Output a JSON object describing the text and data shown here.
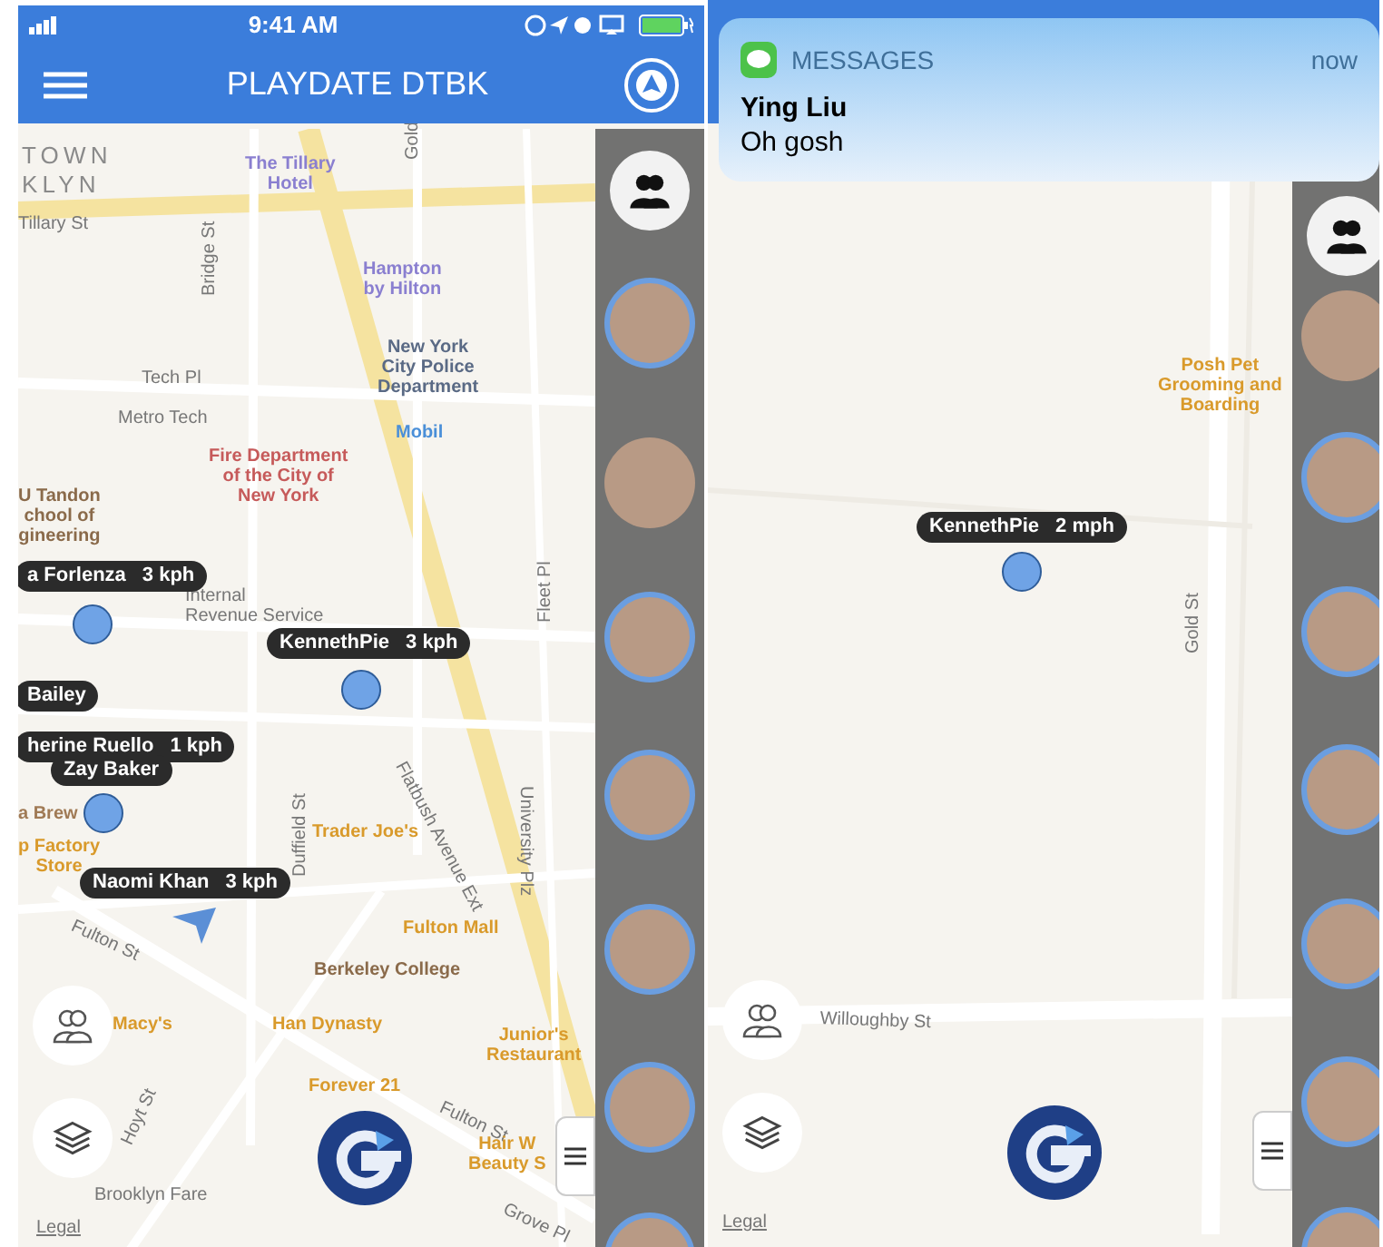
{
  "left_screen": {
    "status_bar": {
      "time": "9:41 AM"
    },
    "header": {
      "title": "PLAYDATE DTBK"
    },
    "map_labels": [
      {
        "text": "TOWN",
        "kind": "district"
      },
      {
        "text": "KLYN",
        "kind": "district"
      },
      {
        "text": "The Tillary\nHotel",
        "kind": "poi",
        "color": "#8a7fd0"
      },
      {
        "text": "Tillary St",
        "kind": "street"
      },
      {
        "text": "Gold",
        "kind": "street"
      },
      {
        "text": "Hampton\nby Hilton",
        "kind": "poi",
        "color": "#8a7fd0"
      },
      {
        "text": "Bridge St",
        "kind": "street"
      },
      {
        "text": "New York\nCity Police\nDepartment",
        "kind": "poi",
        "color": "#5a6a85"
      },
      {
        "text": "Tech Pl",
        "kind": "street"
      },
      {
        "text": "Metro Tech",
        "kind": "street"
      },
      {
        "text": "Fire Department\nof the City of\nNew York",
        "kind": "poi",
        "color": "#c65a5a"
      },
      {
        "text": "Mobil",
        "kind": "poi",
        "color": "#4a8fd8"
      },
      {
        "text": "U Tandon\nchool of\ngineering",
        "kind": "poi",
        "color": "#8a6a4a"
      },
      {
        "text": "Internal\nRevenue Service",
        "kind": "street"
      },
      {
        "text": "Fleet Pl",
        "kind": "street"
      },
      {
        "text": "Flatbush Avenue Ext",
        "kind": "street"
      },
      {
        "text": "a Brew",
        "kind": "poi",
        "color": "#a07a55"
      },
      {
        "text": "p Factory\nStore",
        "kind": "poi",
        "color": "#d99a2b"
      },
      {
        "text": "Trader Joe's",
        "kind": "poi",
        "color": "#d99a2b"
      },
      {
        "text": "Duffield St",
        "kind": "street"
      },
      {
        "text": "University Plz",
        "kind": "street"
      },
      {
        "text": "Fulton St",
        "kind": "street"
      },
      {
        "text": "Fulton Mall",
        "kind": "poi",
        "color": "#d99a2b"
      },
      {
        "text": "Berkeley College",
        "kind": "poi",
        "color": "#8a6a4a"
      },
      {
        "text": "Macy's",
        "kind": "poi",
        "color": "#d99a2b"
      },
      {
        "text": "Han Dynasty",
        "kind": "poi",
        "color": "#d99a2b"
      },
      {
        "text": "Junior's\nRestaurant",
        "kind": "poi",
        "color": "#d99a2b"
      },
      {
        "text": "Forever 21",
        "kind": "poi",
        "color": "#d99a2b"
      },
      {
        "text": "Fulton St",
        "kind": "street"
      },
      {
        "text": "Hoyt St",
        "kind": "street"
      },
      {
        "text": "Hair W\nBeauty S",
        "kind": "poi",
        "color": "#d99a2b"
      },
      {
        "text": "Grove Pl",
        "kind": "street"
      },
      {
        "text": "Brooklyn Fare",
        "kind": "street"
      }
    ],
    "users": [
      {
        "name": "a Forlenza",
        "speed": "3 kph",
        "kind": "dot"
      },
      {
        "name": "KennethPie",
        "speed": "3 kph",
        "kind": "dot"
      },
      {
        "name": "Bailey",
        "kind": "label"
      },
      {
        "name": "herine Ruello",
        "speed": "1 kph",
        "kind": "label"
      },
      {
        "name": "Zay Baker",
        "kind": "dot"
      },
      {
        "name": "Naomi Khan",
        "speed": "3 kph",
        "kind": "arrow"
      }
    ],
    "avatars": [
      {
        "ring": true
      },
      {
        "ring": false
      },
      {
        "ring": true
      },
      {
        "ring": true
      },
      {
        "ring": true
      },
      {
        "ring": true
      },
      {
        "ring": true
      }
    ],
    "legal": "Legal"
  },
  "right_screen": {
    "notification": {
      "app": "MESSAGES",
      "time": "now",
      "sender": "Ying Liu",
      "message": "Oh gosh"
    },
    "map_labels": [
      {
        "text": "Posh Pet\nGrooming and\nBoarding",
        "kind": "poi",
        "color": "#d99a2b"
      },
      {
        "text": "Gold St",
        "kind": "street"
      },
      {
        "text": "Willoughby St",
        "kind": "street"
      }
    ],
    "users": [
      {
        "name": "KennethPie",
        "speed": "2 mph",
        "kind": "dot"
      }
    ],
    "avatars": [
      {
        "ring": false
      },
      {
        "ring": true
      },
      {
        "ring": true
      },
      {
        "ring": true
      },
      {
        "ring": true
      },
      {
        "ring": true
      },
      {
        "ring": true
      }
    ],
    "legal": "Legal"
  }
}
